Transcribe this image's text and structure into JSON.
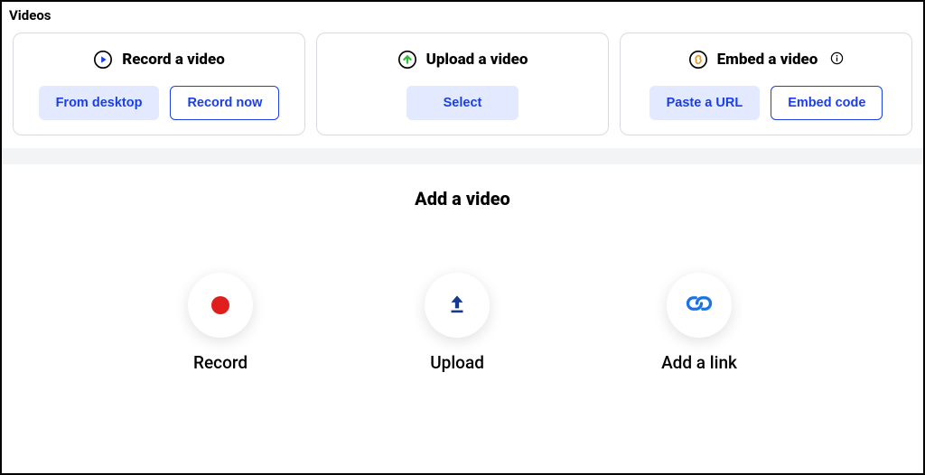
{
  "panel": {
    "title": "Videos"
  },
  "cards": {
    "record": {
      "title": "Record a video",
      "btn_from_desktop": "From desktop",
      "btn_record_now": "Record now"
    },
    "upload": {
      "title": "Upload a video",
      "btn_select": "Select"
    },
    "embed": {
      "title": "Embed a video",
      "btn_paste_url": "Paste a URL",
      "btn_embed_code": "Embed code"
    }
  },
  "lower": {
    "title": "Add a video",
    "options": {
      "record": "Record",
      "upload": "Upload",
      "addlink": "Add a link"
    }
  }
}
